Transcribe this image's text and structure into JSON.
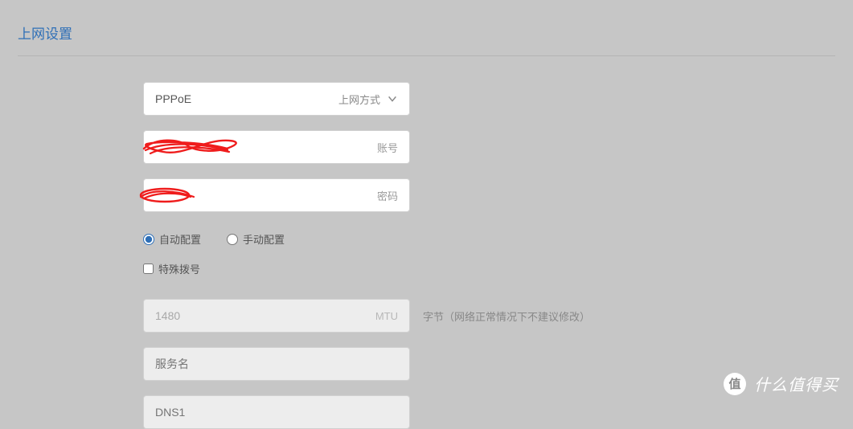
{
  "page": {
    "title": "上网设置"
  },
  "connection": {
    "type_value": "PPPoE",
    "type_label": "上网方式",
    "account_label": "账号",
    "account_value": "",
    "password_label": "密码",
    "password_value": ""
  },
  "config": {
    "auto_label": "自动配置",
    "manual_label": "手动配置",
    "selected": "auto",
    "special_dial_label": "特殊拨号",
    "special_dial_checked": false
  },
  "mtu": {
    "value": "1480",
    "label": "MTU",
    "hint": "字节（网络正常情况下不建议修改）"
  },
  "service": {
    "placeholder": "服务名",
    "value": ""
  },
  "dns": {
    "placeholder": "DNS1",
    "value": ""
  },
  "watermark": {
    "badge": "值",
    "text": "什么值得买"
  }
}
